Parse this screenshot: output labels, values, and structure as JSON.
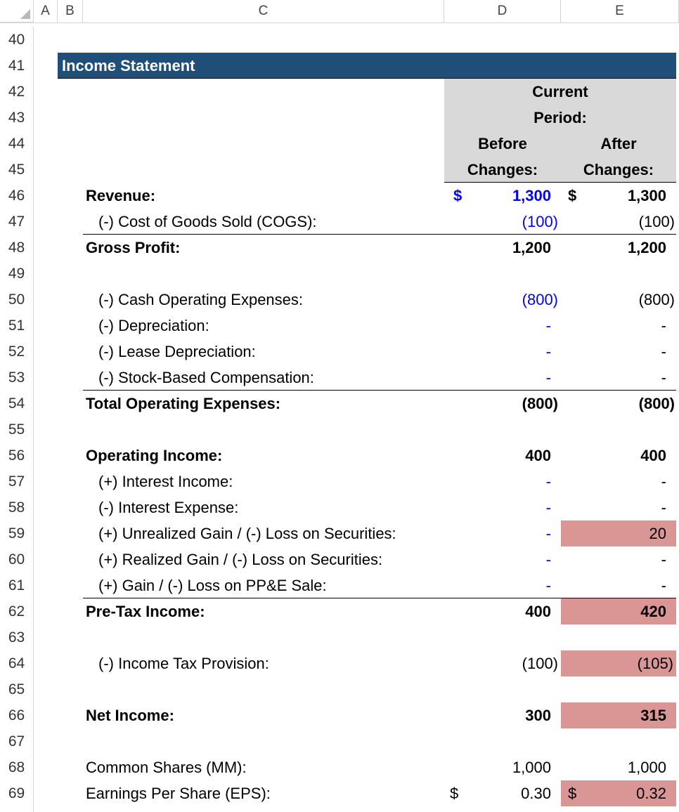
{
  "columns": [
    "A",
    "B",
    "C",
    "D",
    "E"
  ],
  "rows": [
    "40",
    "41",
    "42",
    "43",
    "44",
    "45",
    "46",
    "47",
    "48",
    "49",
    "50",
    "51",
    "52",
    "53",
    "54",
    "55",
    "56",
    "57",
    "58",
    "59",
    "60",
    "61",
    "62",
    "63",
    "64",
    "65",
    "66",
    "67",
    "68",
    "69"
  ],
  "section_title": "Income Statement",
  "header": {
    "line1": "Current",
    "line2": "Period:",
    "before1": "Before",
    "before2": "Changes:",
    "after1": "After",
    "after2": "Changes:"
  },
  "currency_symbol": "$",
  "lines": {
    "revenue": {
      "label": "Revenue:",
      "before": "1,300",
      "after": "1,300"
    },
    "cogs": {
      "label": "(-) Cost of Goods Sold (COGS):",
      "before": "(100)",
      "after": "(100)"
    },
    "gross_profit": {
      "label": "Gross Profit:",
      "before": "1,200",
      "after": "1,200"
    },
    "cash_opex": {
      "label": "(-) Cash Operating Expenses:",
      "before": "(800)",
      "after": "(800)"
    },
    "depreciation": {
      "label": "(-) Depreciation:",
      "before": "-",
      "after": "-"
    },
    "lease_depreciation": {
      "label": "(-) Lease Depreciation:",
      "before": "-",
      "after": "-"
    },
    "sbc": {
      "label": "(-) Stock-Based Compensation:",
      "before": "-",
      "after": "-"
    },
    "total_opex": {
      "label": "Total Operating Expenses:",
      "before": "(800)",
      "after": "(800)"
    },
    "operating_income": {
      "label": "Operating Income:",
      "before": "400",
      "after": "400"
    },
    "interest_income": {
      "label": "(+) Interest Income:",
      "before": "-",
      "after": "-"
    },
    "interest_expense": {
      "label": "(-) Interest Expense:",
      "before": "-",
      "after": "-"
    },
    "unrealized_gain": {
      "label": "(+) Unrealized Gain / (-) Loss on Securities:",
      "before": "-",
      "after": "20"
    },
    "realized_gain": {
      "label": "(+) Realized Gain / (-) Loss on Securities:",
      "before": "-",
      "after": "-"
    },
    "ppe_gain": {
      "label": "(+) Gain / (-) Loss on PP&E Sale:",
      "before": "-",
      "after": "-"
    },
    "pretax_income": {
      "label": "Pre-Tax Income:",
      "before": "400",
      "after": "420"
    },
    "tax_provision": {
      "label": "(-) Income Tax Provision:",
      "before": "(100)",
      "after": "(105)"
    },
    "net_income": {
      "label": "Net Income:",
      "before": "300",
      "after": "315"
    },
    "shares": {
      "label": "Common Shares (MM):",
      "before": "1,000",
      "after": "1,000"
    },
    "eps": {
      "label": "Earnings Per Share (EPS):",
      "before": "0.30",
      "after": "0.32"
    }
  },
  "colors": {
    "title_band": "#1f4e79",
    "header_gray": "#d9d9d9",
    "changed_highlight": "#da9694",
    "input_blue": "#0000ff"
  }
}
